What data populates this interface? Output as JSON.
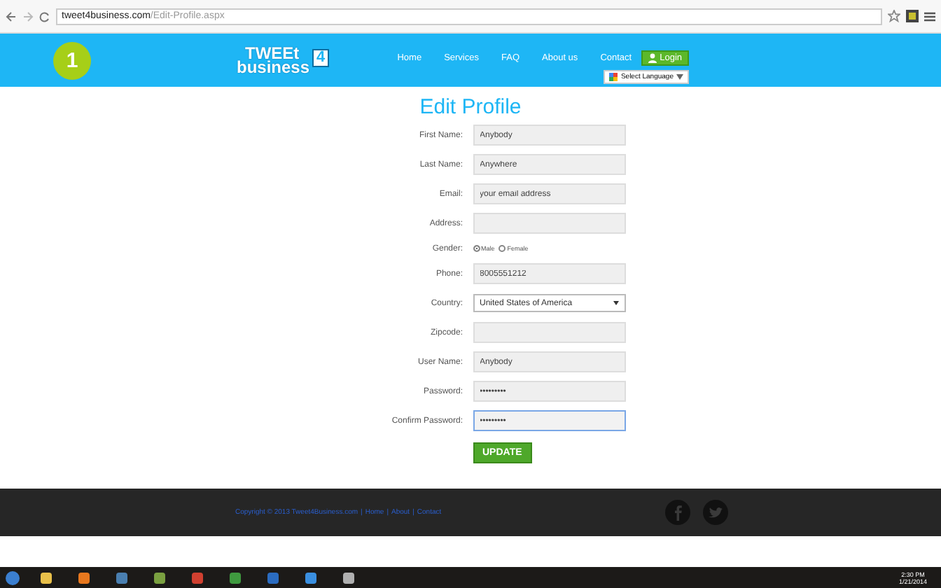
{
  "browser": {
    "url_host": "tweet4business.com",
    "url_path": "/Edit-Profile.aspx"
  },
  "header": {
    "badge": "1",
    "logo_line_1": "TWEEt",
    "logo_line_2": "business",
    "logo_mark": "4",
    "nav": [
      {
        "label": "Home"
      },
      {
        "label": "Services"
      },
      {
        "label": "FAQ"
      },
      {
        "label": "About us"
      },
      {
        "label": "Contact"
      }
    ],
    "login": "Login",
    "language": "Select Language"
  },
  "title": "Edit Profile",
  "fields": [
    {
      "label": "First Name:",
      "kind": "text",
      "value": "Anybody"
    },
    {
      "label": "Last Name:",
      "kind": "text",
      "value": "Anywhere"
    },
    {
      "label": "Email:",
      "kind": "text",
      "placeholder": "your email address"
    },
    {
      "label": "Address:",
      "kind": "text"
    },
    {
      "label": "Gender:",
      "kind": "radio",
      "options": [
        {
          "label": "Male",
          "selected": true
        },
        {
          "label": "Female",
          "selected": false
        }
      ]
    },
    {
      "label": "Phone:",
      "kind": "text",
      "value": "8005551212"
    },
    {
      "label": "Country:",
      "kind": "select",
      "value": "United States of America"
    },
    {
      "label": "Zipcode:",
      "kind": "text"
    },
    {
      "label": "User Name:",
      "kind": "text",
      "value": "Anybody"
    },
    {
      "label": "Password:",
      "kind": "text",
      "value": "•••••••••"
    },
    {
      "label": "Confirm Password:",
      "kind": "text",
      "value": "•••••••••",
      "focused": true
    }
  ],
  "submit": "UPDATE",
  "footer": {
    "copyright": "Copyright © 2013 Tweet4Business.com",
    "separator": "|",
    "links": [
      {
        "label": "Home"
      },
      {
        "label": "About"
      },
      {
        "label": "Contact"
      }
    ]
  },
  "taskbar": {
    "time": "2:30 PM",
    "date": "1/21/2014"
  }
}
